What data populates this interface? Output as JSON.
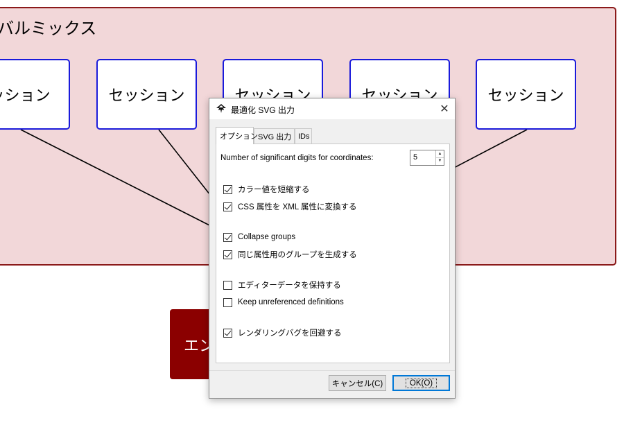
{
  "diagram": {
    "group_title": "バルミックス",
    "sessions": [
      "ッション",
      "セッション",
      "セッション",
      "セッション",
      "セッション"
    ],
    "red_button_label": "エン",
    "colors": {
      "group_fill": "#f2d7d9",
      "group_border": "#8b1a1a",
      "session_border": "#1a1adb",
      "red_button": "#8b0000"
    }
  },
  "dialog": {
    "title": "最適化 SVG 出力",
    "app_icon": "inkscape-icon",
    "close_icon": "close-icon",
    "tabs": [
      {
        "label": "オプション",
        "active": true
      },
      {
        "label": "SVG 出力",
        "active": false
      },
      {
        "label": "IDs",
        "active": false
      }
    ],
    "precision": {
      "label": "Number of significant digits for coordinates:",
      "value": "5"
    },
    "options": [
      {
        "label": "カラー値を短縮する",
        "checked": true
      },
      {
        "label": "CSS 属性を XML 属性に変換する",
        "checked": true
      },
      {
        "label": "Collapse groups",
        "checked": true
      },
      {
        "label": "同じ属性用のグループを生成する",
        "checked": true
      },
      {
        "label": "エディターデータを保持する",
        "checked": false
      },
      {
        "label": "Keep unreferenced definitions",
        "checked": false
      },
      {
        "label": "レンダリングバグを回避する",
        "checked": true
      }
    ],
    "buttons": {
      "cancel": "キャンセル(C)",
      "ok": "OK(O)"
    }
  }
}
